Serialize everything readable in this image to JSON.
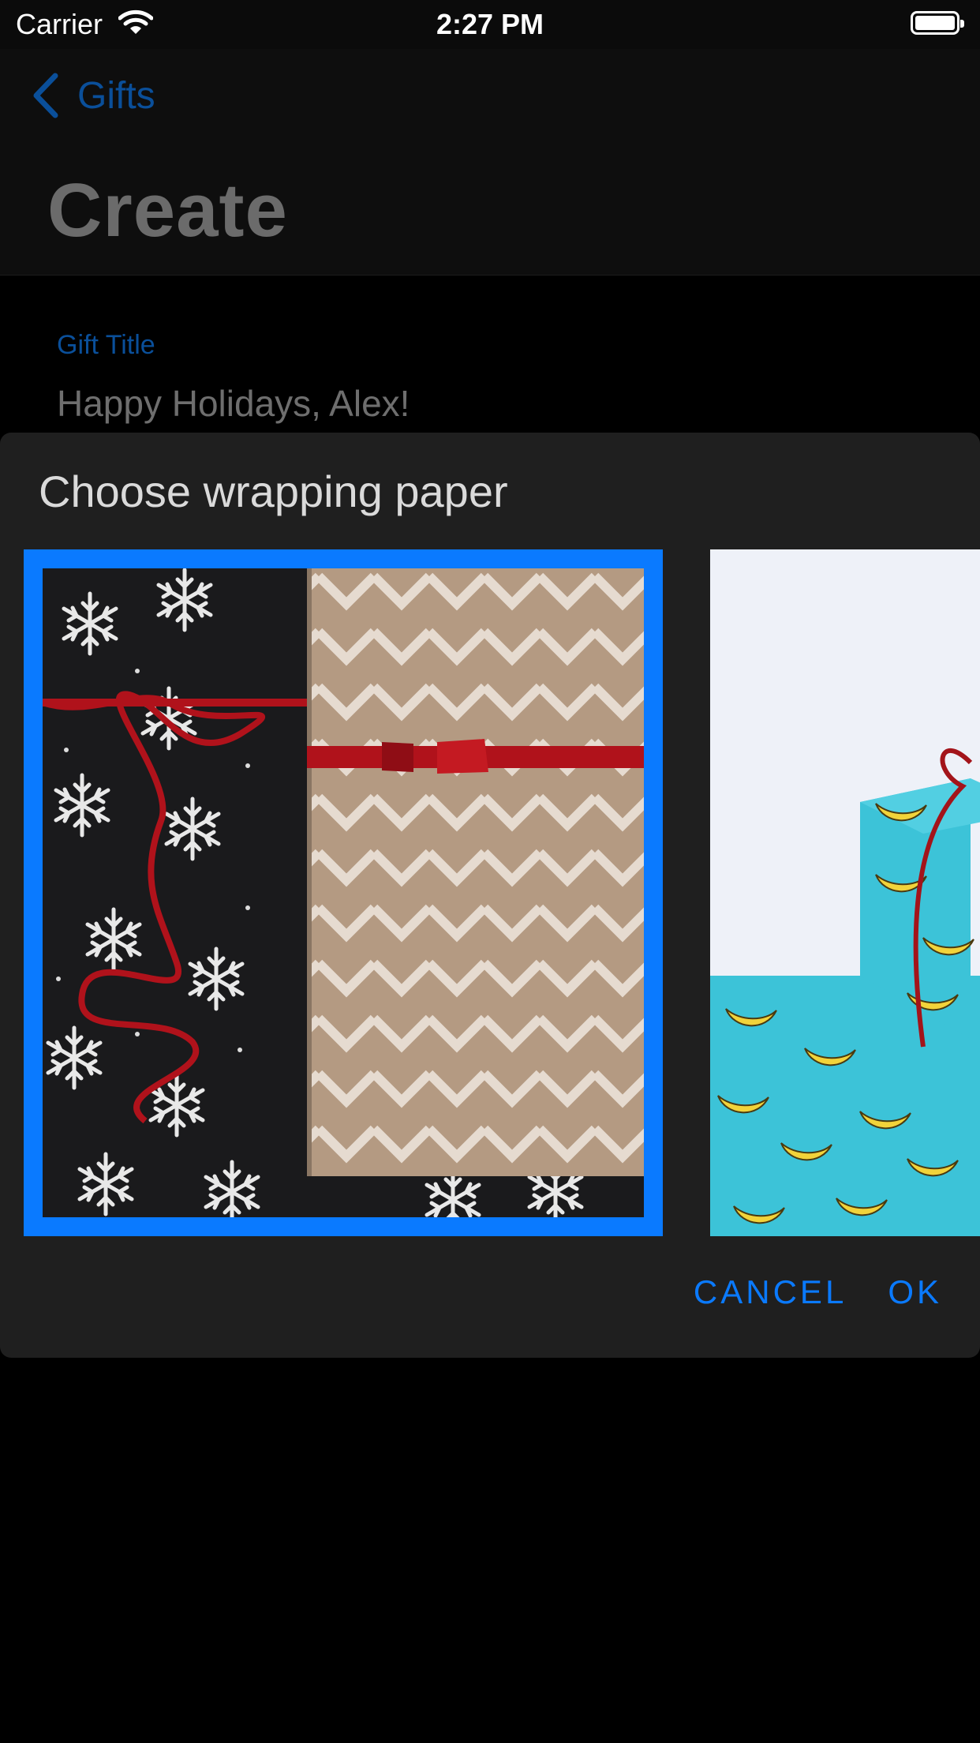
{
  "status_bar": {
    "carrier": "Carrier",
    "time": "2:27 PM"
  },
  "nav": {
    "back_label": "Gifts",
    "title": "Create"
  },
  "form": {
    "gift_title_label": "Gift Title",
    "gift_title_value": "Happy Holidays, Alex!"
  },
  "dialog": {
    "title": "Choose wrapping paper",
    "options": [
      {
        "name": "snowflake-and-chevron-paper",
        "selected": true
      },
      {
        "name": "banana-print-paper",
        "selected": false
      }
    ],
    "cancel_label": "CANCEL",
    "ok_label": "OK"
  },
  "colors": {
    "accent": "#0a7aff",
    "dim_accent": "#0a4f9a",
    "dialog_bg": "#1f1f1f",
    "banana_paper": "#3cc3d8",
    "kraft_paper": "#b49a82",
    "ribbon": "#b0121b"
  },
  "icons": {
    "back": "chevron-left-icon",
    "wifi": "wifi-icon",
    "battery": "battery-icon"
  }
}
